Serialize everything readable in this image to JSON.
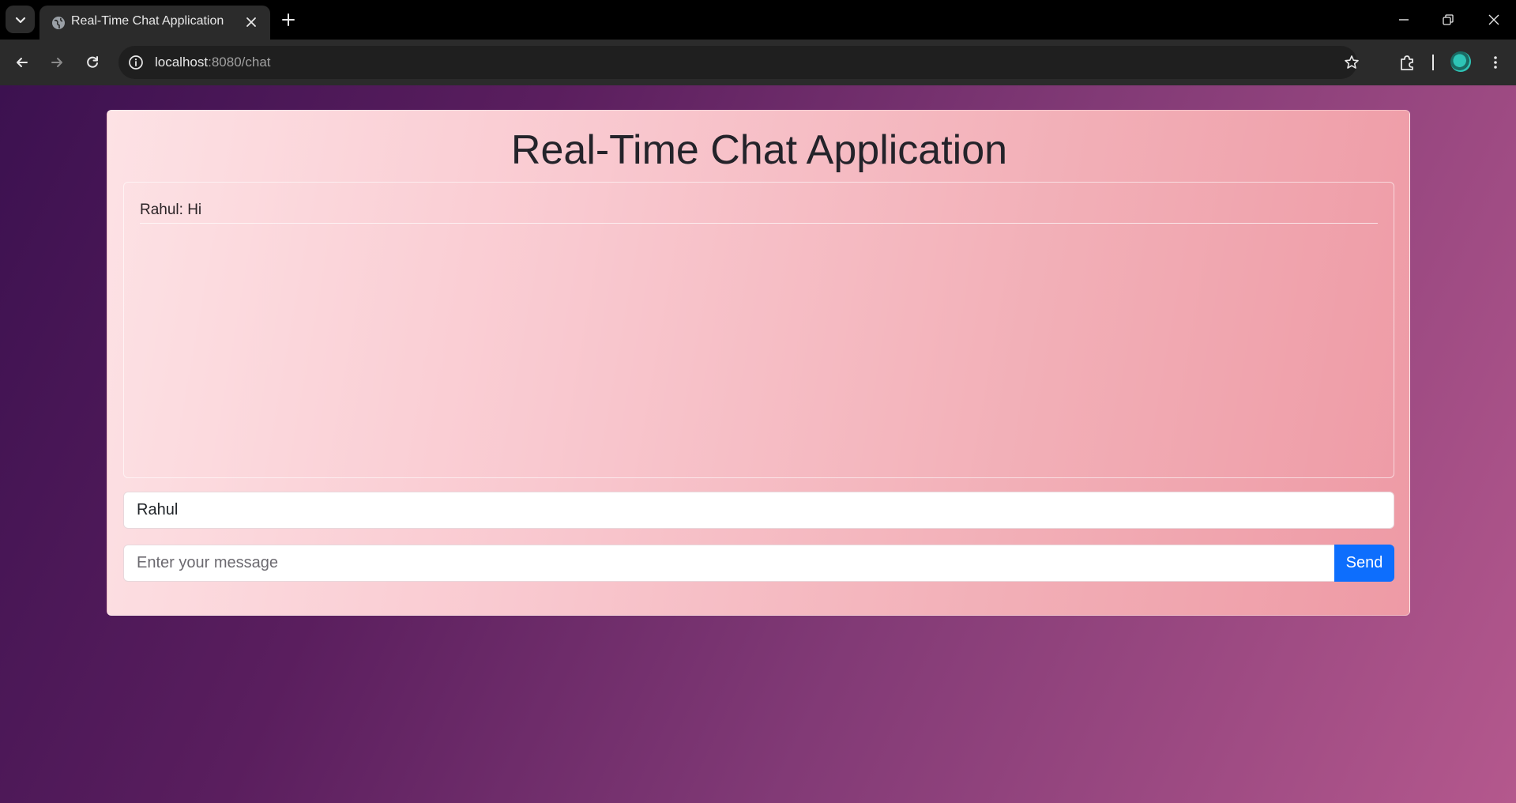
{
  "browser": {
    "tab_title": "Real-Time Chat Application",
    "url_host": "localhost",
    "url_rest": ":8080/chat"
  },
  "page": {
    "title": "Real-Time Chat Application",
    "messages": [
      {
        "text": "Rahul: Hi"
      }
    ],
    "name_input": {
      "value": "Rahul"
    },
    "message_input": {
      "value": "",
      "placeholder": "Enter your message"
    },
    "send_label": "Send"
  },
  "colors": {
    "send_button": "#0d6efd",
    "background_start": "#3c1150",
    "background_end": "#b4588d"
  }
}
